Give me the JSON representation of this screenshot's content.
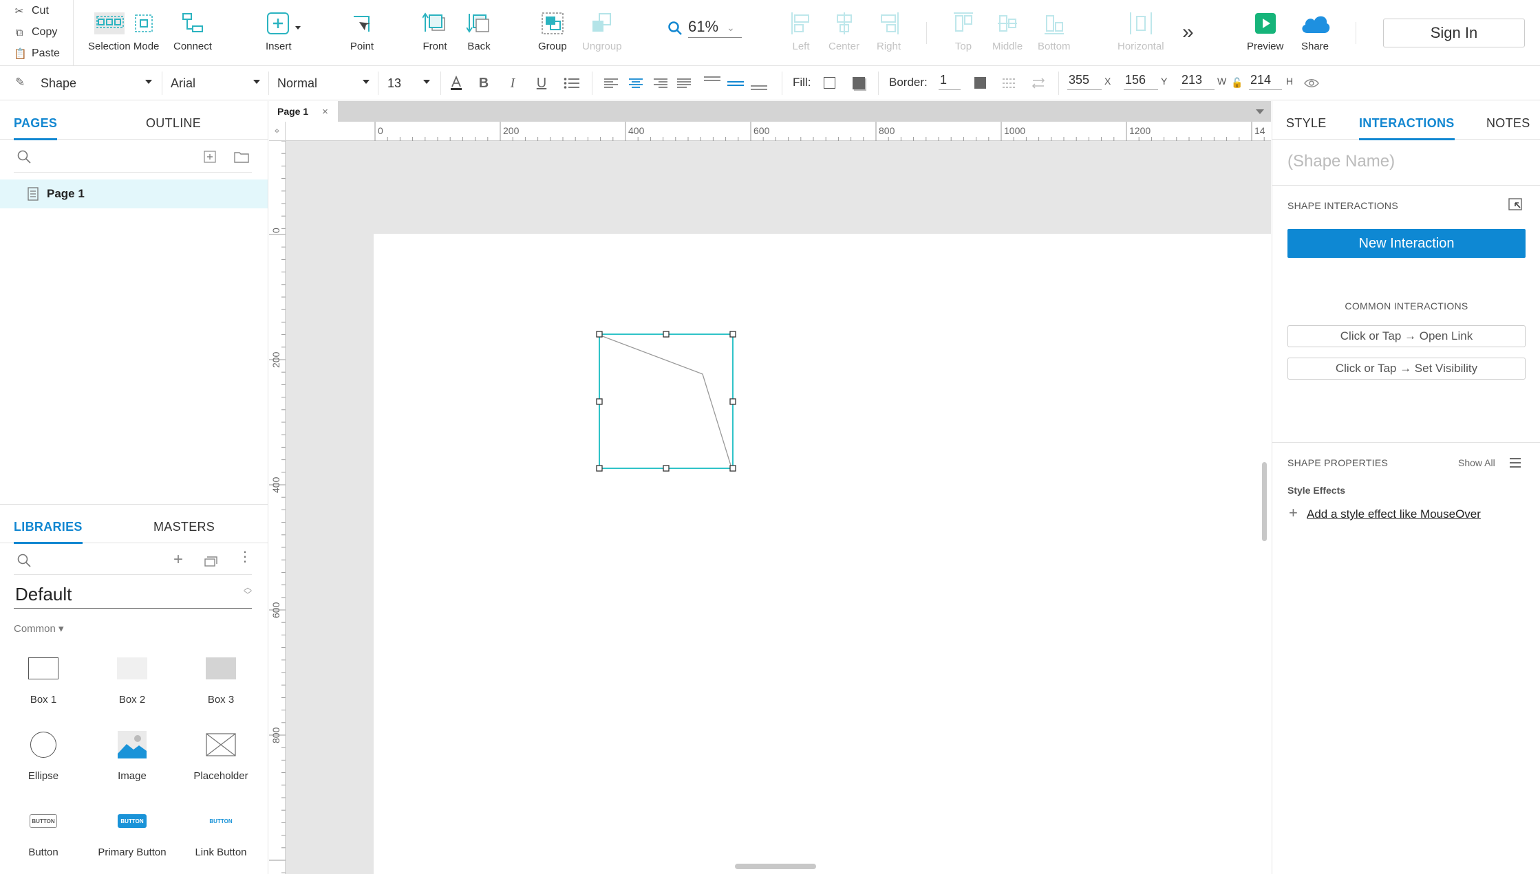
{
  "clipboard": {
    "cut": "Cut",
    "copy": "Copy",
    "paste": "Paste"
  },
  "toolbar": {
    "selection_mode": "Selection Mode",
    "connect": "Connect",
    "insert": "Insert",
    "point": "Point",
    "front": "Front",
    "back": "Back",
    "group": "Group",
    "ungroup": "Ungroup",
    "zoom": "61%",
    "align_left": "Left",
    "align_center": "Center",
    "align_right": "Right",
    "align_top": "Top",
    "align_middle": "Middle",
    "align_bottom": "Bottom",
    "distribute_horizontal": "Horizontal",
    "preview": "Preview",
    "share": "Share",
    "sign_in": "Sign In"
  },
  "format": {
    "style_select": "Shape",
    "font_select": "Arial",
    "weight_select": "Normal",
    "size_select": "13",
    "fill_label": "Fill:",
    "border_label": "Border:",
    "border_value": "1",
    "x_value": "355",
    "x_label": "X",
    "y_value": "156",
    "y_label": "Y",
    "w_value": "213",
    "w_label": "W",
    "h_value": "214",
    "h_label": "H"
  },
  "left_panel": {
    "tabs": [
      "PAGES",
      "OUTLINE"
    ],
    "pages": [
      {
        "label": "Page 1"
      }
    ],
    "lib_tabs": [
      "LIBRARIES",
      "MASTERS"
    ],
    "library_name": "Default",
    "category": "Common ▾",
    "widgets": [
      {
        "label": "Box 1"
      },
      {
        "label": "Box 2"
      },
      {
        "label": "Box 3"
      },
      {
        "label": "Ellipse"
      },
      {
        "label": "Image"
      },
      {
        "label": "Placeholder"
      },
      {
        "label": "Button",
        "thumb_text": "BUTTON"
      },
      {
        "label": "Primary Button",
        "thumb_text": "BUTTON"
      },
      {
        "label": "Link Button",
        "thumb_text": "BUTTON"
      }
    ]
  },
  "canvas": {
    "page_tab": "Page 1",
    "ruler_h": [
      "0",
      "200",
      "400",
      "600",
      "800",
      "1000",
      "1200",
      "14"
    ],
    "ruler_v": [
      "0",
      "200",
      "400",
      "600",
      "800"
    ]
  },
  "right_panel": {
    "tabs": [
      "STYLE",
      "INTERACTIONS",
      "NOTES"
    ],
    "shape_name_placeholder": "(Shape Name)",
    "shape_interactions": "SHAPE INTERACTIONS",
    "new_interaction": "New Interaction",
    "common_interactions": "COMMON INTERACTIONS",
    "common": [
      "Click or Tap → Open Link",
      "Click or Tap → Set Visibility"
    ],
    "shape_properties": "SHAPE PROPERTIES",
    "show_all": "Show All",
    "style_effects": "Style Effects",
    "add_effect": "Add a style effect like MouseOver"
  },
  "colors": {
    "accent": "#1287d1",
    "primary_button": "#0e88d3",
    "selection": "#2fc3c8",
    "toolbar_icon": "#2bb3c0"
  }
}
